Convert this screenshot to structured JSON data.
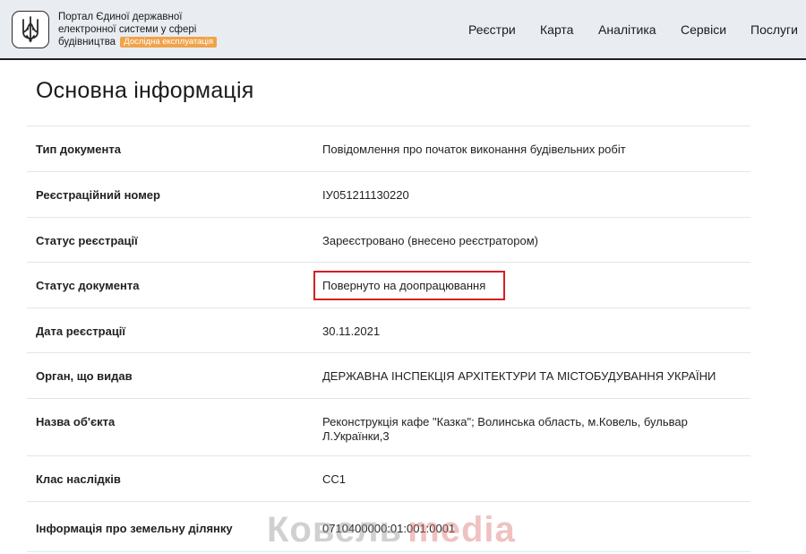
{
  "header": {
    "portal_line1": "Портал Єдиної державної",
    "portal_line2": "електронної системи у сфері",
    "portal_line3": "будівництва",
    "beta_badge": "Дослідна експлуатація",
    "accent_color": "#f0a34a",
    "nav": [
      "Реєстри",
      "Карта",
      "Аналітика",
      "Сервіси",
      "Послуги"
    ]
  },
  "page": {
    "title": "Основна інформація"
  },
  "info_rows": [
    {
      "label": "Тип документа",
      "value": "Повідомлення про початок виконання будівельних робіт"
    },
    {
      "label": "Реєстраційний номер",
      "value": "ІУ051211130220"
    },
    {
      "label": "Статус реєстрації",
      "value": "Зареєстровано (внесено реєстратором)"
    },
    {
      "label": "Статус документа",
      "value": "Повернуто на доопрацювання",
      "highlighted": true
    },
    {
      "label": "Дата реєстрації",
      "value": "30.11.2021"
    },
    {
      "label": "Орган, що видав",
      "value": "ДЕРЖАВНА ІНСПЕКЦІЯ АРХІТЕКТУРИ ТА МІСТОБУДУВАННЯ УКРАЇНИ"
    },
    {
      "label": "Назва об'єкта",
      "value": "Реконструкція кафе \"Казка\"; Волинська область, м.Ковель, бульвар Л.Українки,3"
    },
    {
      "label": "Клас наслідків",
      "value": "СС1"
    },
    {
      "label": "Інформація про земельну ділянку",
      "value": "0710400000:01:001:0001"
    }
  ],
  "highlight_color": "#d42020",
  "watermark": {
    "part1": "Ковель",
    "part2": "media"
  }
}
